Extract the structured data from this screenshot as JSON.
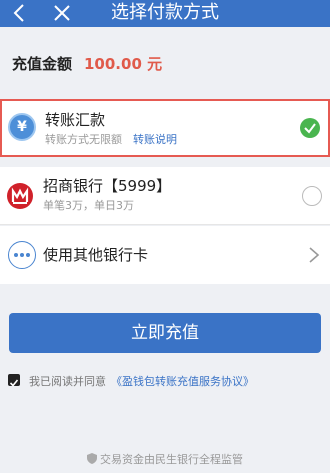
{
  "header": {
    "title": "选择付款方式",
    "back_icon": "chevron-left-icon",
    "close_icon": "close-icon",
    "bg_color": "#3a73c6"
  },
  "amount": {
    "label": "充值金额",
    "value": "100.00 元",
    "value_color": "#e05a4a"
  },
  "options": [
    {
      "title": "转账汇款",
      "subtitle": "转账方式无限额",
      "link": "转账说明",
      "icon": "yuan-icon",
      "selected": true
    },
    {
      "title": "招商银行【5999】",
      "subtitle": "单笔3万，单日3万",
      "icon": "cmb-logo-icon",
      "selected": false
    },
    {
      "title": "使用其他银行卡",
      "icon": "more-dots-icon"
    }
  ],
  "submit_label": "立即充值",
  "agreement": {
    "checked": true,
    "text": "我已阅读并同意",
    "link": "《盈钱包转账充值服务协议》"
  },
  "footer": {
    "text": "交易资金由民生银行全程监管"
  },
  "colors": {
    "accent": "#3a73c6",
    "selected_border": "#e65a52",
    "check": "#4ab54f"
  }
}
